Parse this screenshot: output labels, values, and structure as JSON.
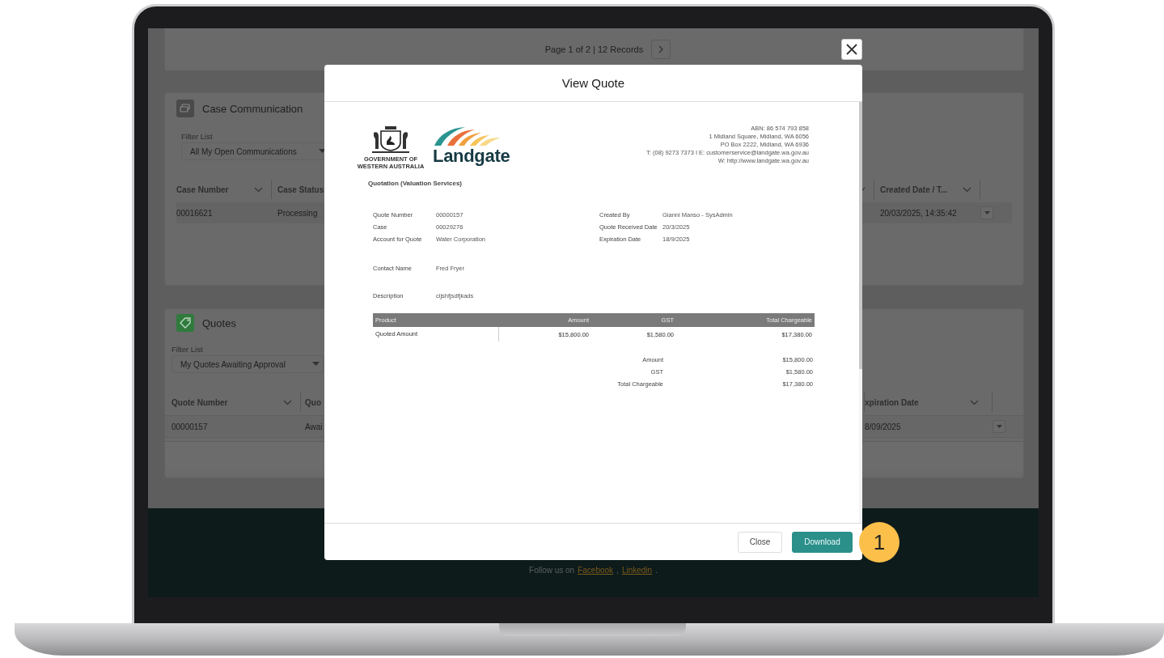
{
  "pager": {
    "text": "Page 1 of 2 | 12 Records"
  },
  "case_communication": {
    "title": "Case Communication",
    "filter_label": "Filter List",
    "filter_value": "All My Open Communications",
    "columns": [
      {
        "label": "Case Number"
      },
      {
        "label": "Case Status"
      },
      {
        "label": "Created Date / T..."
      }
    ],
    "rows": [
      {
        "cells": [
          "00016621",
          "Processing",
          "20/03/2025, 14:35:42"
        ]
      }
    ]
  },
  "quotes": {
    "title": "Quotes",
    "filter_label": "Filter List",
    "filter_value": "My Quotes Awaiting Approval",
    "columns": [
      {
        "label": "Quote Number"
      },
      {
        "label": "Quo"
      },
      {
        "label": "xpiration Date"
      }
    ],
    "rows": [
      {
        "cells": [
          "00000157",
          "Awai",
          "8/09/2025"
        ]
      }
    ]
  },
  "footer": {
    "prefix": "Follow us on",
    "links": [
      {
        "label": "Facebook"
      },
      {
        "label": "Linkedin"
      }
    ],
    "separator": ",",
    "suffix": "."
  },
  "modal": {
    "title": "View Quote",
    "document": {
      "crest_caption": [
        "GOVERNMENT OF",
        "WESTERN AUSTRALIA"
      ],
      "logo_text": "Landgate",
      "address_lines": [
        "ABN: 86 574 793 858",
        "1 Midland Square, Midland, WA 6056",
        "PO Box 2222, Midland, WA 6936",
        "T: (08) 9273 7373 I E: customerservice@landgate.wa.gov.au",
        "W: http://www.landgate.wa.gov.au"
      ],
      "heading": "Quotation (Valuation Services)",
      "fields_left": [
        {
          "label": "Quote Number",
          "value": "00000157"
        },
        {
          "label": "Case",
          "value": "00029276"
        },
        {
          "label": "Account for Quote",
          "value": "Water Corporation"
        }
      ],
      "fields_right": [
        {
          "label": "Created By",
          "value": "Gianni Manso - SysAdmin"
        },
        {
          "label": "Quote Received Date",
          "value": "20/3/2025"
        },
        {
          "label": "Expiration Date",
          "value": "18/9/2025"
        }
      ],
      "fields_extra": [
        {
          "label": "Contact Name",
          "value": "Fred Fryer"
        },
        {
          "label": "Description",
          "value": "cijshfjsdfjkads"
        }
      ],
      "table": {
        "columns": [
          "Product",
          "Amount",
          "GST",
          "Total Chargeable"
        ],
        "rows": [
          [
            "Quoted Amount",
            "$15,800.00",
            "$1,580.00",
            "$17,380.00"
          ]
        ]
      },
      "totals": [
        {
          "label": "Amount",
          "value": "$15,800.00"
        },
        {
          "label": "GST",
          "value": "$1,580.00"
        },
        {
          "label": "Total Chargeable",
          "value": "$17,380.00"
        }
      ]
    },
    "buttons": [
      {
        "label": "Close",
        "kind": "secondary"
      },
      {
        "label": "Download",
        "kind": "primary"
      }
    ]
  },
  "callout": {
    "label": "1"
  }
}
